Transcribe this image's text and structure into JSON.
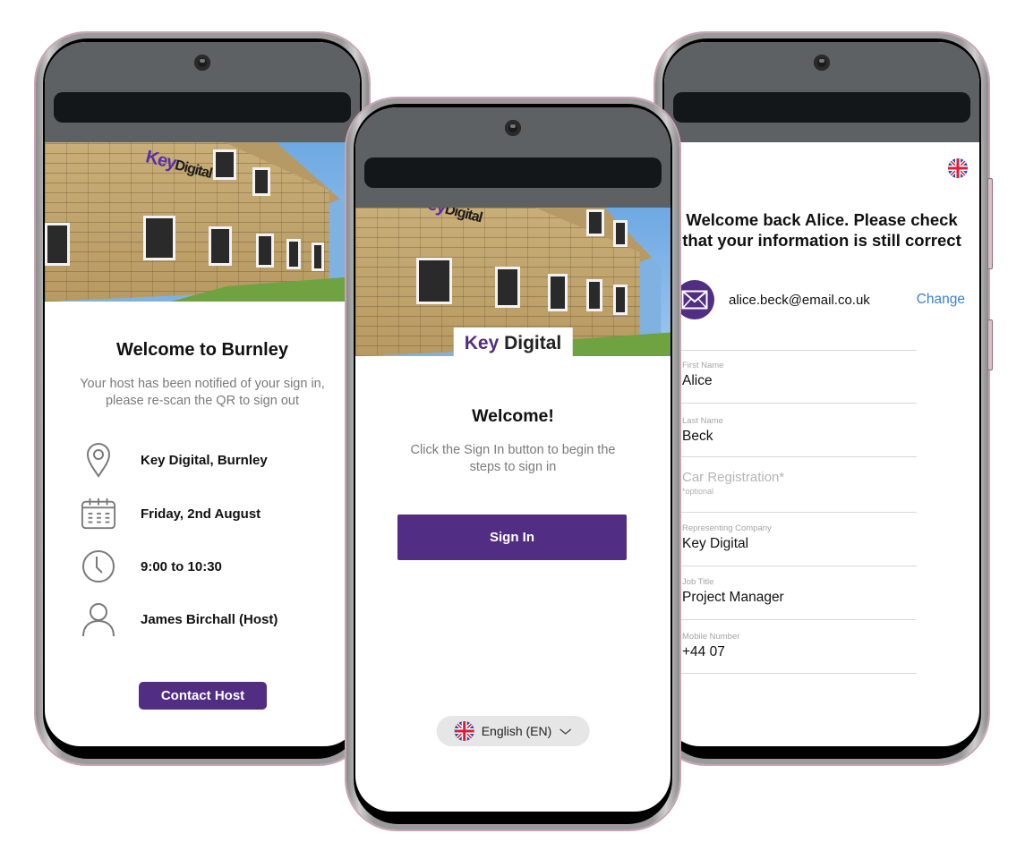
{
  "colors": {
    "brand_purple": "#522d84",
    "link_blue": "#3d7fcf",
    "statusbar_gray": "#5e6163",
    "pill_gray": "#e6e6e6",
    "subtext_gray": "#7b7b7b",
    "frame_pink": "#c9a4b4"
  },
  "screens": {
    "confirmation": {
      "photo_sign": {
        "key": "Key",
        "digital": "Digital"
      },
      "title": "Welcome to Burnley",
      "subtitle_line1": "Your host has been notified of your sign in,",
      "subtitle_line2": "please re-scan the QR to sign out",
      "details": [
        {
          "icon": "location-pin-icon",
          "text": "Key Digital, Burnley"
        },
        {
          "icon": "calendar-icon",
          "text": "Friday, 2nd August"
        },
        {
          "icon": "clock-icon",
          "text": "9:00 to 10:30"
        },
        {
          "icon": "person-icon",
          "text": "James Birchall (Host)"
        }
      ],
      "contact_button": "Contact Host"
    },
    "welcome": {
      "brand": {
        "key": "Key",
        "digital": "Digital"
      },
      "title": "Welcome!",
      "subtitle_line1": "Click the Sign In button to  begin the",
      "subtitle_line2": "steps to sign in",
      "sign_in_button": "Sign In",
      "language": {
        "icon": "uk-flag-icon",
        "selected": "English (EN)",
        "chevron": "chevron-down-icon"
      }
    },
    "details_form": {
      "language_icon": "uk-flag-icon",
      "title_line1": "Welcome back Alice. Please check",
      "title_line2": "that your information is still correct",
      "email": {
        "icon": "envelope-icon",
        "value": "alice.beck@email.co.uk",
        "change_link": "Change"
      },
      "fields": [
        {
          "label": "First Name",
          "value": "Alice"
        },
        {
          "label": "Last Name",
          "value": "Beck"
        },
        {
          "label": "",
          "placeholder": "Car Registration*",
          "hint": "*optional",
          "value": ""
        },
        {
          "label": "Representing Company",
          "value": "Key Digital"
        },
        {
          "label": "Job Title",
          "value": "Project Manager"
        },
        {
          "label": "Mobile Number",
          "value": "+44 07"
        }
      ]
    }
  }
}
